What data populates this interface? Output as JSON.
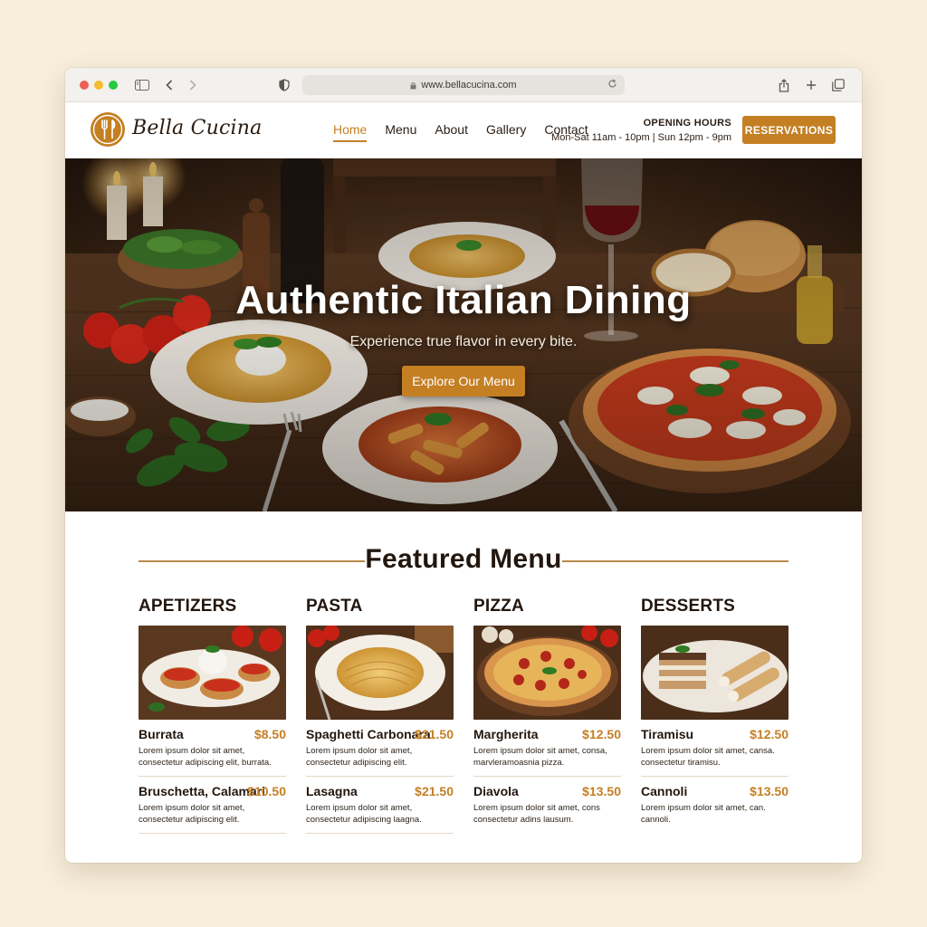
{
  "browser": {
    "url": "www.bellacucina.com"
  },
  "site": {
    "name": "Bella Cucina",
    "nav": [
      {
        "label": "Home",
        "active": true
      },
      {
        "label": "Menu",
        "active": false
      },
      {
        "label": "About",
        "active": false
      },
      {
        "label": "Gallery",
        "active": false
      },
      {
        "label": "Contact",
        "active": false
      }
    ],
    "hours_title": "OPENING HOURS",
    "hours_text": "Mon-Sat 11am - 10pm | Sun 12pm - 9pm",
    "reserve_label": "RESERVATIONS"
  },
  "hero": {
    "title": "Authentic Italian Dining",
    "subtitle": "Experience true flavor in every bite.",
    "cta": "Explore Our Menu"
  },
  "featured": {
    "title": "Featured Menu",
    "categories": [
      {
        "heading": "APETIZERS",
        "items": [
          {
            "name": "Burrata",
            "price": "$8.50",
            "desc": "Lorem ipsum dolor sit amet, consectetur adipiscing elit, burrata."
          },
          {
            "name": "Bruschetta, Calamari",
            "price": "$10.50",
            "desc": "Lorem ipsum dolor sit amet, consectetur adipiscing elit."
          }
        ]
      },
      {
        "heading": "PASTA",
        "items": [
          {
            "name": "Spaghetti Carbonara",
            "price": "$21.50",
            "desc": "Lorem ipsum dolor sit amet, consectetur adipiscing elit."
          },
          {
            "name": "Lasagna",
            "price": "$21.50",
            "desc": "Lorem ipsum dolor sit amet, consectetur adipiscing laagna."
          }
        ]
      },
      {
        "heading": "PIZZA",
        "items": [
          {
            "name": "Margherita",
            "price": "$12.50",
            "desc": "Lorem ipsum dolor sit amet, consa, marvleramoasnia pizza."
          },
          {
            "name": "Diavola",
            "price": "$13.50",
            "desc": "Lorem ipsum dolor sit amet, cons consectetur adins lausum."
          }
        ]
      },
      {
        "heading": "DESSERTS",
        "items": [
          {
            "name": "Tiramisu",
            "price": "$12.50",
            "desc": "Lorem ipsum dolor sit amet, cansa. consectetur tiramisu."
          },
          {
            "name": "Cannoli",
            "price": "$13.50",
            "desc": "Lorem ipsum dolor sit amet, can. cannoli."
          }
        ]
      }
    ]
  },
  "colors": {
    "accent": "#c47f23",
    "page_bg": "#f8eedb",
    "text_dark": "#22160e"
  }
}
